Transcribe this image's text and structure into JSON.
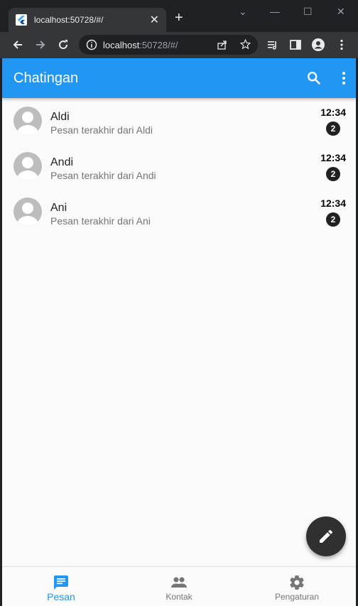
{
  "browser": {
    "tab_title": "localhost:50728/#/",
    "url_host": "localhost",
    "url_rest": ":50728/#/"
  },
  "app": {
    "title": "Chatingan",
    "accent_color": "#2196f3"
  },
  "chats": [
    {
      "name": "Aldi",
      "preview": "Pesan terakhir dari Aldi",
      "time": "12:34",
      "unread": "2"
    },
    {
      "name": "Andi",
      "preview": "Pesan terakhir dari Andi",
      "time": "12:34",
      "unread": "2"
    },
    {
      "name": "Ani",
      "preview": "Pesan terakhir dari Ani",
      "time": "12:34",
      "unread": "2"
    }
  ],
  "bottom_nav": {
    "items": [
      {
        "label": "Pesan",
        "icon": "message-icon",
        "active": true
      },
      {
        "label": "Kontak",
        "icon": "people-icon",
        "active": false
      },
      {
        "label": "Pengaturan",
        "icon": "gear-icon",
        "active": false
      }
    ]
  },
  "fab": {
    "icon": "pencil-icon"
  }
}
